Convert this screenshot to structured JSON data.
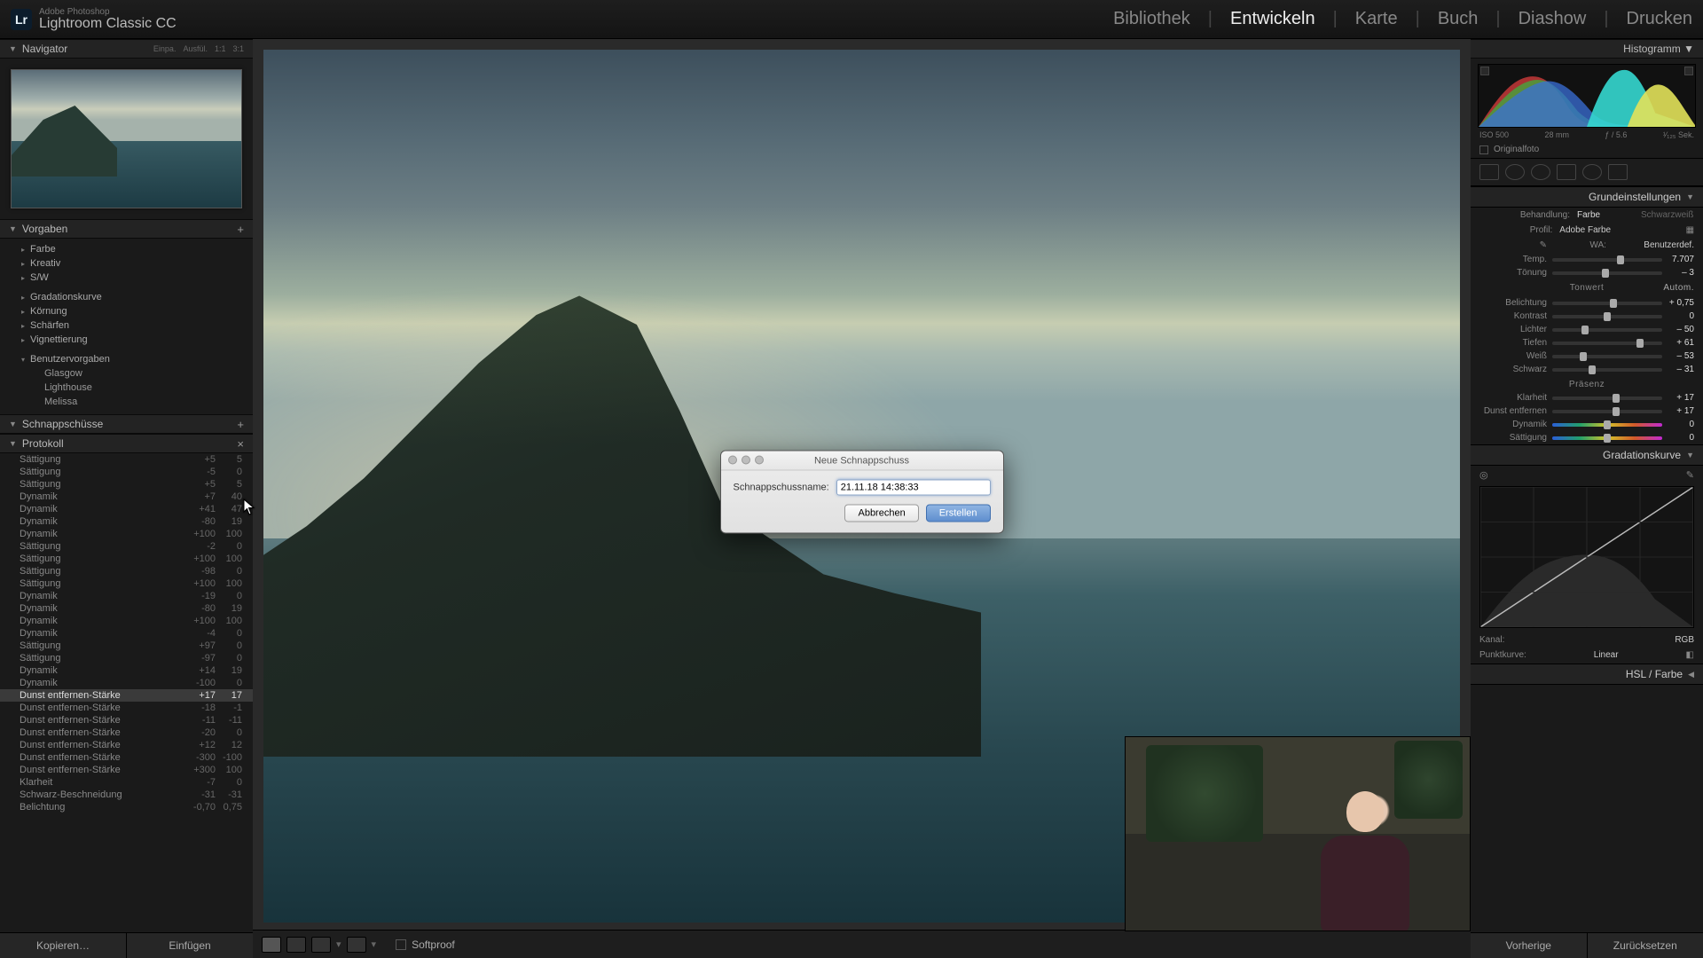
{
  "app": {
    "brand_line": "Adobe Photoshop",
    "brand_name": "Lightroom Classic CC",
    "logo_text": "Lr"
  },
  "modules": {
    "items": [
      "Bibliothek",
      "Entwickeln",
      "Karte",
      "Buch",
      "Diashow",
      "Drucken"
    ],
    "active_index": 1
  },
  "navigator": {
    "title": "Navigator",
    "meta": [
      "Einpa.",
      "Ausfül.",
      "1:1",
      "3:1"
    ]
  },
  "presets": {
    "title": "Vorgaben",
    "groups": [
      "Farbe",
      "Kreativ",
      "S/W"
    ],
    "groups2": [
      "Gradationskurve",
      "Körnung",
      "Schärfen",
      "Vignettierung"
    ],
    "user_head": "Benutzervorgaben",
    "user": [
      "Glasgow",
      "Lighthouse",
      "Melissa"
    ]
  },
  "snapshots": {
    "title": "Schnappschüsse"
  },
  "history": {
    "title": "Protokoll",
    "rows": [
      {
        "n": "Sättigung",
        "a": "+5",
        "b": "5"
      },
      {
        "n": "Sättigung",
        "a": "-5",
        "b": "0"
      },
      {
        "n": "Sättigung",
        "a": "+5",
        "b": "5"
      },
      {
        "n": "Dynamik",
        "a": "+7",
        "b": "40"
      },
      {
        "n": "Dynamik",
        "a": "+41",
        "b": "47"
      },
      {
        "n": "Dynamik",
        "a": "-80",
        "b": "19"
      },
      {
        "n": "Dynamik",
        "a": "+100",
        "b": "100"
      },
      {
        "n": "Sättigung",
        "a": "-2",
        "b": "0"
      },
      {
        "n": "Sättigung",
        "a": "+100",
        "b": "100"
      },
      {
        "n": "Sättigung",
        "a": "-98",
        "b": "0"
      },
      {
        "n": "Sättigung",
        "a": "+100",
        "b": "100"
      },
      {
        "n": "Dynamik",
        "a": "-19",
        "b": "0"
      },
      {
        "n": "Dynamik",
        "a": "-80",
        "b": "19"
      },
      {
        "n": "Dynamik",
        "a": "+100",
        "b": "100"
      },
      {
        "n": "Dynamik",
        "a": "-4",
        "b": "0"
      },
      {
        "n": "Sättigung",
        "a": "+97",
        "b": "0"
      },
      {
        "n": "Sättigung",
        "a": "-97",
        "b": "0"
      },
      {
        "n": "Dynamik",
        "a": "+14",
        "b": "19"
      },
      {
        "n": "Dynamik",
        "a": "-100",
        "b": "0"
      },
      {
        "n": "Dunst entfernen-Stärke",
        "a": "+17",
        "b": "17",
        "sel": true
      },
      {
        "n": "Dunst entfernen-Stärke",
        "a": "-18",
        "b": "-1"
      },
      {
        "n": "Dunst entfernen-Stärke",
        "a": "-11",
        "b": "-11"
      },
      {
        "n": "Dunst entfernen-Stärke",
        "a": "-20",
        "b": "0"
      },
      {
        "n": "Dunst entfernen-Stärke",
        "a": "+12",
        "b": "12"
      },
      {
        "n": "Dunst entfernen-Stärke",
        "a": "-300",
        "b": "-100"
      },
      {
        "n": "Dunst entfernen-Stärke",
        "a": "+300",
        "b": "100"
      },
      {
        "n": "Klarheit",
        "a": "-7",
        "b": "0"
      },
      {
        "n": "Schwarz-Beschneidung",
        "a": "-31",
        "b": "-31"
      },
      {
        "n": "Belichtung",
        "a": "-0,70",
        "b": "0,75"
      }
    ]
  },
  "left_buttons": {
    "copy": "Kopieren…",
    "paste": "Einfügen"
  },
  "center_bar": {
    "softproof": "Softproof"
  },
  "histogram": {
    "title": "Histogramm ▼",
    "meta": [
      "ISO 500",
      "28 mm",
      "ƒ / 5.6",
      "¹⁄₁₂₅ Sek."
    ],
    "orig": "Originalfoto"
  },
  "basic": {
    "title": "Grundeinstellungen",
    "treat_label": "Behandlung:",
    "treat_color": "Farbe",
    "treat_bw": "Schwarzweiß",
    "profile_label": "Profil:",
    "profile_value": "Adobe Farbe",
    "wb_label": "WA:",
    "wb_value": "Benutzerdef.",
    "sliders_wb": [
      {
        "l": "Temp.",
        "v": "7.707",
        "p": 62
      },
      {
        "l": "Tönung",
        "v": "– 3",
        "p": 48
      }
    ],
    "tone_head": "Tonwert",
    "tone_auto": "Autom.",
    "sliders_tone": [
      {
        "l": "Belichtung",
        "v": "+ 0,75",
        "p": 56
      },
      {
        "l": "Kontrast",
        "v": "0",
        "p": 50
      },
      {
        "l": "Lichter",
        "v": "– 50",
        "p": 30
      },
      {
        "l": "Tiefen",
        "v": "+ 61",
        "p": 80
      },
      {
        "l": "Weiß",
        "v": "– 53",
        "p": 28
      },
      {
        "l": "Schwarz",
        "v": "– 31",
        "p": 36
      }
    ],
    "presence_head": "Präsenz",
    "sliders_presence": [
      {
        "l": "Klarheit",
        "v": "+ 17",
        "p": 58
      },
      {
        "l": "Dunst entfernen",
        "v": "+ 17",
        "p": 58
      },
      {
        "l": "Dynamik",
        "v": "0",
        "p": 50,
        "rainbow": true
      },
      {
        "l": "Sättigung",
        "v": "0",
        "p": 50,
        "rainbow": true
      }
    ]
  },
  "curve": {
    "title": "Gradationskurve",
    "channel_label": "Kanal:",
    "channel_value": "RGB",
    "pointcurve_label": "Punktkurve:",
    "pointcurve_value": "Linear"
  },
  "hsl": {
    "title": "HSL / Farbe"
  },
  "right_buttons": {
    "prev": "Vorherige",
    "reset": "Zurücksetzen"
  },
  "modal": {
    "title": "Neue Schnappschuss",
    "label": "Schnappschussname:",
    "value": "21.11.18 14:38:33",
    "cancel": "Abbrechen",
    "ok": "Erstellen"
  }
}
